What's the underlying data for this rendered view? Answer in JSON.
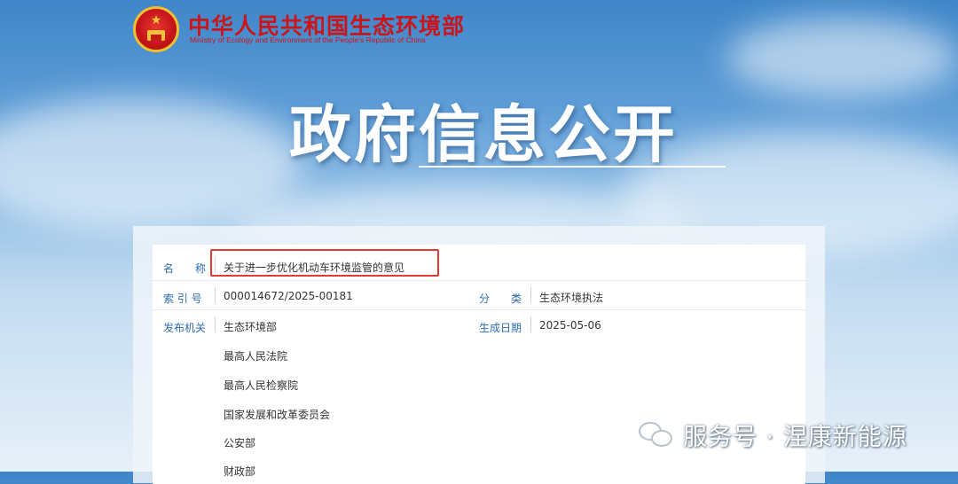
{
  "header": {
    "emblem_icon": "national-emblem-icon",
    "title_cn": "中华人民共和国生态环境部",
    "title_en": "Ministry of Ecology and Environment of the People's Republic of China"
  },
  "hero": {
    "title": "政府信息公开"
  },
  "document": {
    "name_label": "名　　称",
    "name_value": "关于进一步优化机动车环境监管的意见",
    "index_label": "索 引 号",
    "index_value": "000014672/2025-00181",
    "category_label": "分　　类",
    "category_value": "生态环境执法",
    "publisher_label": "发布机关",
    "publishers": [
      "生态环境部",
      "最高人民法院",
      "最高人民检察院",
      "国家发展和改革委员会",
      "公安部",
      "财政部"
    ],
    "date_label": "生成日期",
    "date_value": "2025-05-06"
  },
  "watermark": {
    "icon": "wechat-icon",
    "text": "服务号 · 涅康新能源"
  },
  "colors": {
    "brand_red": "#c8161b",
    "label_blue": "#2b6cb0",
    "highlight_red": "#e53935"
  }
}
